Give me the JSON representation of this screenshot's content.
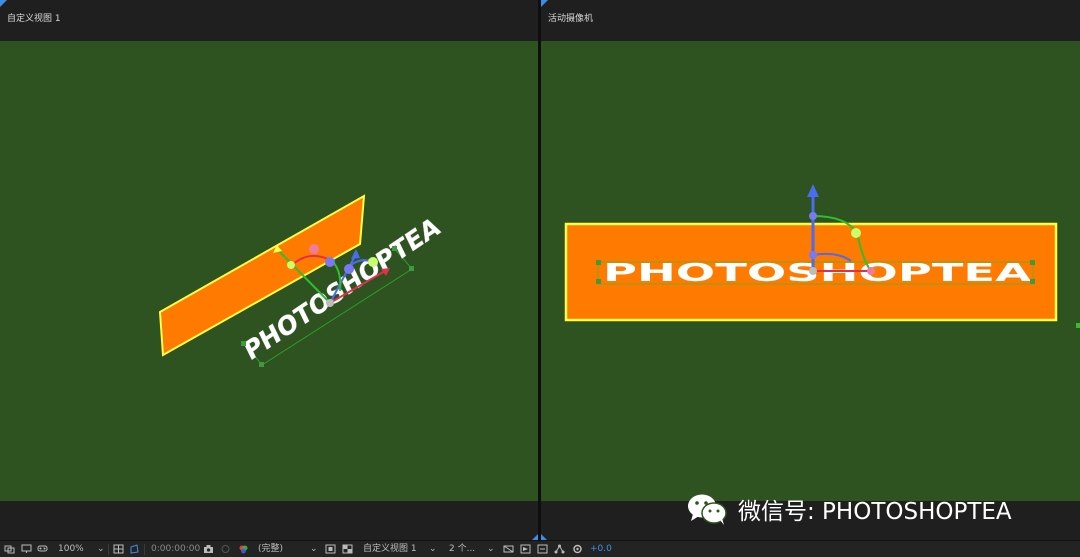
{
  "left_viewer": {
    "title": "自定义视图 1",
    "scene_text": "PHOTOSHOPTEA"
  },
  "right_viewer": {
    "title": "活动摄像机",
    "scene_text": "PHOTOSHOPTEA"
  },
  "colors": {
    "canvas_bg": "#2f5221",
    "solid_orange": "#ff7a00",
    "selection_yellow": "#ffff4a",
    "axis_blue": "#4a6cf0",
    "axis_green": "#2cc02c",
    "axis_red": "#e0304a",
    "accent_blue": "#3f8ee5"
  },
  "toolbar": {
    "zoom": "100%",
    "timecode": "0:00:00:00",
    "resolution": "(完整)",
    "view_layout": "自定义视图 1",
    "view_count": "2 个...",
    "exposure": "+0.0"
  },
  "watermark": {
    "text": "微信号: PHOTOSHOPTEA"
  }
}
